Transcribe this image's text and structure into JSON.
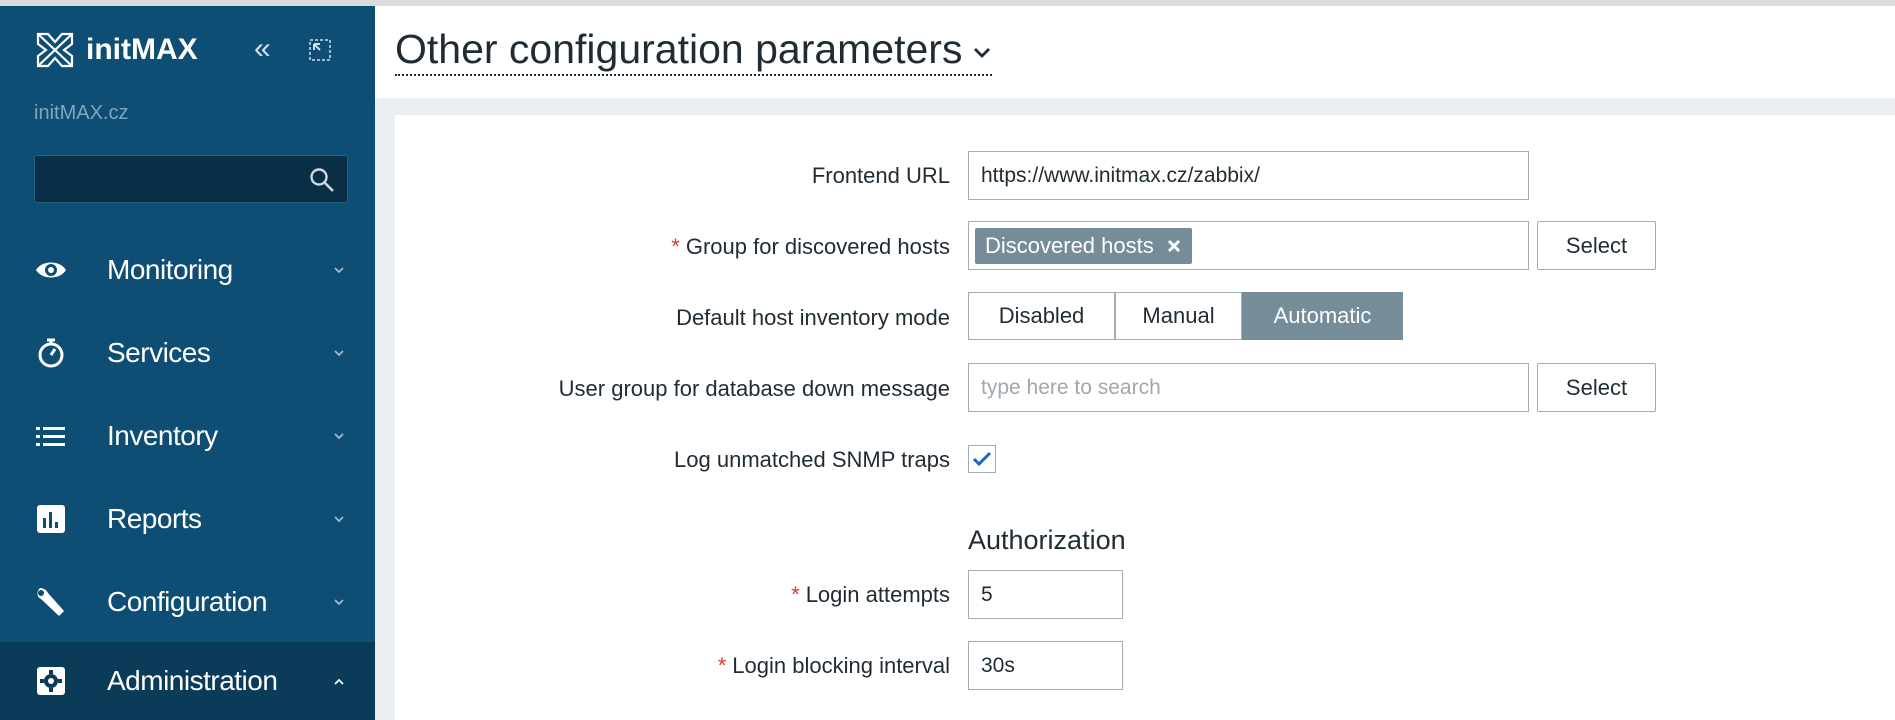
{
  "app": {
    "brand": "initMAX",
    "org": "initMAX.cz",
    "collapse_glyph": "«"
  },
  "sidebar": {
    "search_value": "",
    "items": [
      {
        "label": "Monitoring",
        "icon": "eye-icon",
        "expanded": false
      },
      {
        "label": "Services",
        "icon": "stopwatch-icon",
        "expanded": false
      },
      {
        "label": "Inventory",
        "icon": "list-icon",
        "expanded": false
      },
      {
        "label": "Reports",
        "icon": "bar-chart-icon",
        "expanded": false
      },
      {
        "label": "Configuration",
        "icon": "wrench-icon",
        "expanded": false
      },
      {
        "label": "Administration",
        "icon": "gear-icon",
        "expanded": true
      }
    ]
  },
  "header": {
    "title": "Other configuration parameters"
  },
  "form": {
    "frontend_url": {
      "label": "Frontend URL",
      "value": "https://www.initmax.cz/zabbix/"
    },
    "discovered_group": {
      "label": "Group for discovered hosts",
      "required": "*",
      "chip": "Discovered hosts",
      "select_label": "Select"
    },
    "inventory_mode": {
      "label": "Default host inventory mode",
      "options": [
        "Disabled",
        "Manual",
        "Automatic"
      ],
      "selected": "Automatic"
    },
    "db_down_group": {
      "label": "User group for database down message",
      "placeholder": "type here to search",
      "select_label": "Select"
    },
    "snmp_traps": {
      "label": "Log unmatched SNMP traps",
      "checked": true
    },
    "authorization": {
      "title": "Authorization",
      "login_attempts": {
        "label": "Login attempts",
        "required": "*",
        "value": "5"
      },
      "blocking_interval": {
        "label": "Login blocking interval",
        "required": "*",
        "value": "30s"
      }
    }
  },
  "colors": {
    "sidebar": "#0e4d74",
    "sidebar_active": "#0a3b59",
    "accent_chip": "#768d99",
    "required": "#e33734",
    "check": "#1f65c9"
  }
}
